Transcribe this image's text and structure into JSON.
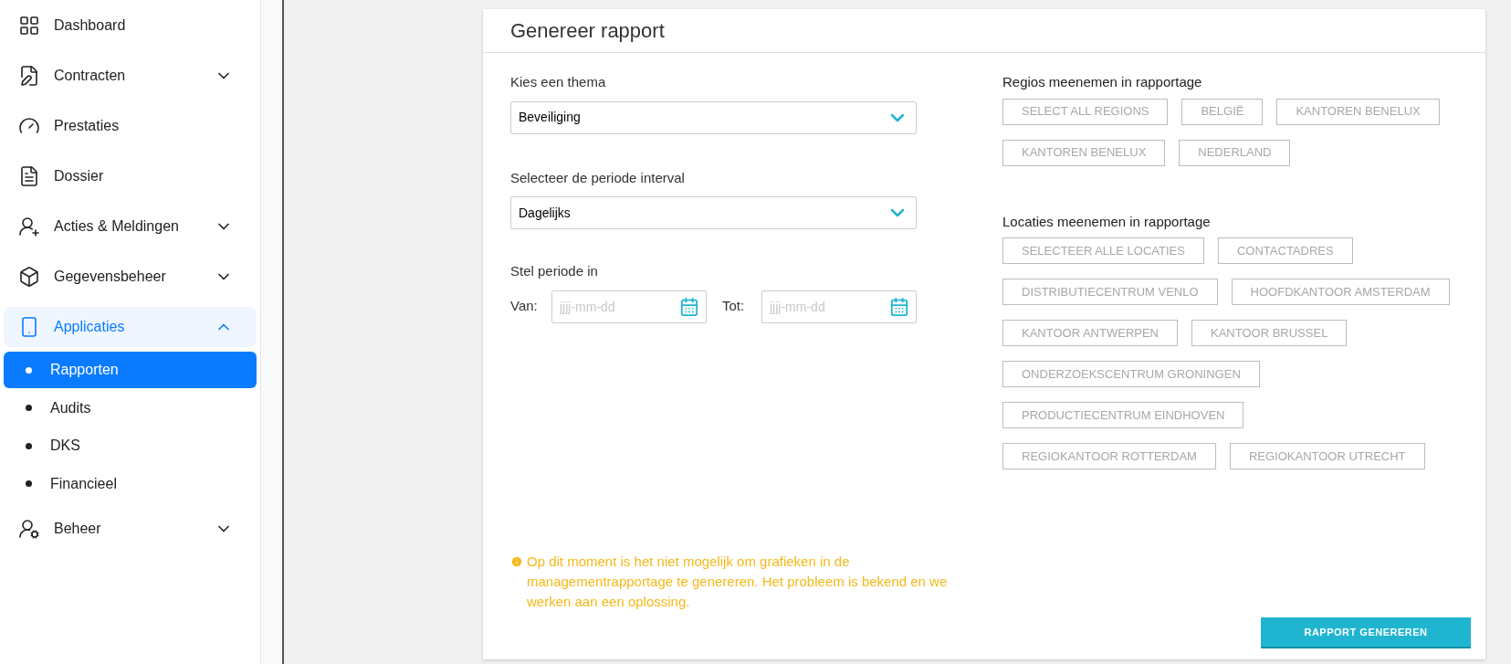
{
  "sidebar": {
    "items": [
      {
        "label": "Dashboard",
        "selected": false
      },
      {
        "label": "Contracten",
        "expanded": false,
        "selected": false
      },
      {
        "label": "Prestaties",
        "selected": false
      },
      {
        "label": "Dossier",
        "selected": false
      },
      {
        "label": "Acties & Meldingen",
        "expanded": false,
        "selected": false
      },
      {
        "label": "Gegevensbeheer",
        "expanded": false,
        "selected": false
      },
      {
        "label": "Applicaties",
        "expanded": true,
        "selected": true,
        "children": [
          {
            "label": "Rapporten",
            "selected": true
          },
          {
            "label": "Audits",
            "selected": false
          },
          {
            "label": "DKS",
            "selected": false
          },
          {
            "label": "Financieel",
            "selected": false
          }
        ]
      },
      {
        "label": "Beheer",
        "expanded": false,
        "selected": false
      }
    ]
  },
  "card": {
    "title": "Genereer rapport",
    "theme": {
      "label": "Kies een thema",
      "value": "Beveiliging"
    },
    "interval": {
      "label": "Selecteer de periode interval",
      "value": "Dagelijks"
    },
    "period": {
      "label": "Stel periode in",
      "from_label": "Van:",
      "from_placeholder": "jjjj-mm-dd",
      "to_label": "Tot:",
      "to_placeholder": "jjjj-mm-dd"
    },
    "regions": {
      "label": "Regios meenemen in rapportage",
      "options": [
        {
          "label": "SELECT ALL REGIONS",
          "selected": false
        },
        {
          "label": "BELGIË",
          "selected": false
        },
        {
          "label": "KANTOREN BENELUX",
          "selected": false
        },
        {
          "label": "KANTOREN BENELUX",
          "selected": false
        },
        {
          "label": "NEDERLAND",
          "selected": false
        }
      ]
    },
    "locations": {
      "label": "Locaties meenemen in rapportage",
      "options": [
        {
          "label": "SELECTEER ALLE LOCATIES",
          "selected": false
        },
        {
          "label": "CONTACTADRES",
          "selected": false
        },
        {
          "label": "DISTRIBUTIECENTRUM VENLO",
          "selected": false
        },
        {
          "label": "HOOFDKANTOOR AMSTERDAM",
          "selected": false
        },
        {
          "label": "KANTOOR ANTWERPEN",
          "selected": false
        },
        {
          "label": "KANTOOR BRUSSEL",
          "selected": false
        },
        {
          "label": "ONDERZOEKSCENTRUM GRONINGEN",
          "selected": false
        },
        {
          "label": "PRODUCTIECENTRUM EINDHOVEN",
          "selected": false
        },
        {
          "label": "REGIOKANTOOR ROTTERDAM",
          "selected": false
        },
        {
          "label": "REGIOKANTOOR UTRECHT",
          "selected": false
        }
      ]
    },
    "notice": "Op dit moment is het niet mogelijk om grafieken in de managementrapportage te genereren. Het probleem is bekend en we werken aan een oplossing.",
    "submit": "RAPPORT GENEREREN"
  }
}
